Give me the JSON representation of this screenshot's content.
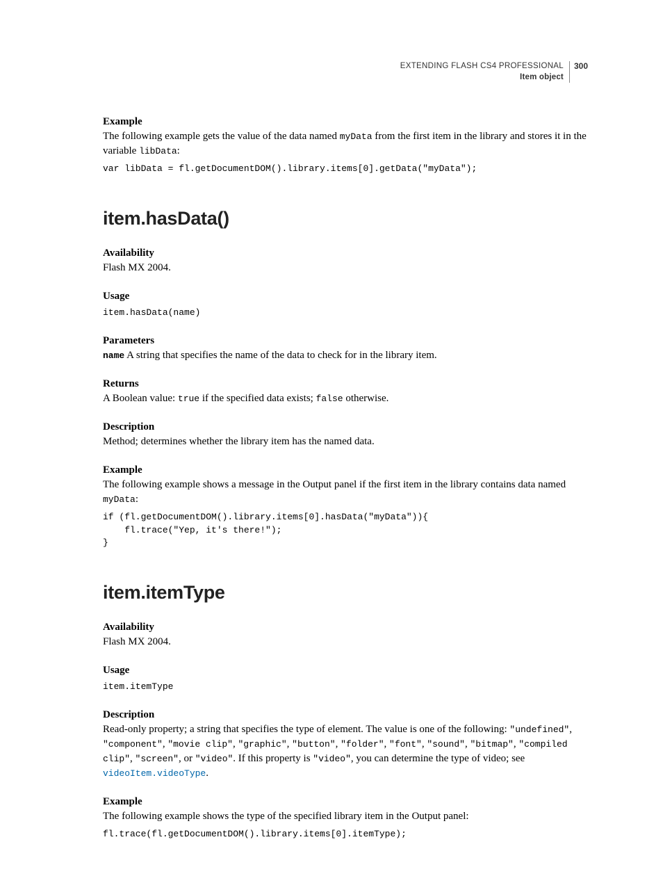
{
  "header": {
    "line1": "EXTENDING FLASH CS4 PROFESSIONAL",
    "line2": "Item object",
    "pageNum": "300"
  },
  "s_example": {
    "label": "Example",
    "text_a": "The following example gets the value of the data named ",
    "text_code1": "myData",
    "text_b": " from the first item in the library and stores it in the variable ",
    "text_code2": "libData",
    "text_c": ":",
    "code": "var libData = fl.getDocumentDOM().library.items[0].getData(\"myData\");"
  },
  "hasData": {
    "title": "item.hasData()",
    "avail_label": "Availability",
    "avail_text": "Flash MX 2004.",
    "usage_label": "Usage",
    "usage_code": "item.hasData(name)",
    "params_label": "Parameters",
    "param_name": "name",
    "param_text": "  A string that specifies the name of the data to check for in the library item.",
    "returns_label": "Returns",
    "returns_a": "A Boolean value: ",
    "returns_true": "true",
    "returns_b": " if the specified data exists; ",
    "returns_false": "false",
    "returns_c": " otherwise.",
    "desc_label": "Description",
    "desc_text": "Method; determines whether the library item has the named data.",
    "ex_label": "Example",
    "ex_text_a": "The following example shows a message in the Output panel if the first item in the library contains data named ",
    "ex_code_inline": "myData",
    "ex_text_b": ":",
    "ex_code": "if (fl.getDocumentDOM().library.items[0].hasData(\"myData\")){\n    fl.trace(\"Yep, it's there!\");\n}"
  },
  "itemType": {
    "title": "item.itemType",
    "avail_label": "Availability",
    "avail_text": "Flash MX 2004.",
    "usage_label": "Usage",
    "usage_code": "item.itemType",
    "desc_label": "Description",
    "desc_a": "Read-only property; a string that specifies the type of element. The value is one of the following: ",
    "c_undefined": "\"undefined\"",
    "desc_comma": ", ",
    "c_component": "\"component\"",
    "c_movieclip": "\"movie clip\"",
    "c_graphic": "\"graphic\"",
    "c_button": "\"button\"",
    "c_folder": "\"folder\"",
    "c_font": "\"font\"",
    "c_sound": "\"sound\"",
    "c_bitmap": "\"bitmap\"",
    "c_compiled": "\"compiled clip\"",
    "c_screen": "\"screen\"",
    "desc_or": ", or ",
    "c_video": "\"video\"",
    "desc_b": ". If this property is ",
    "c_video2": "\"video\"",
    "desc_c": ", you can determine the type of video; see ",
    "xref": "videoItem.videoType",
    "desc_d": ".",
    "ex_label": "Example",
    "ex_text": "The following example shows the type of the specified library item in the Output panel:",
    "ex_code": "fl.trace(fl.getDocumentDOM().library.items[0].itemType);"
  }
}
